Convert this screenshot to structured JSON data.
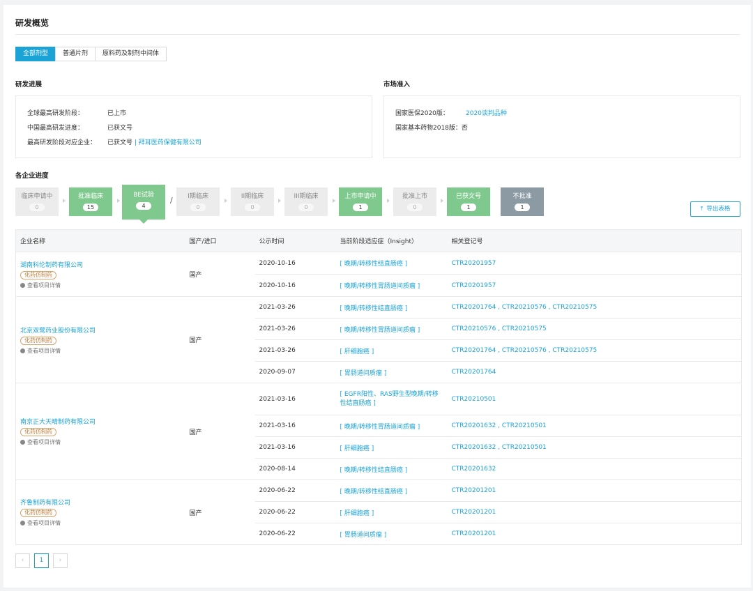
{
  "page_title": "研发概览",
  "tabs": [
    "全部剂型",
    "普通片剂",
    "原料药及制剂中间体"
  ],
  "research_progress": {
    "title": "研发进展",
    "rows": [
      {
        "label": "全球最高研发阶段：",
        "value": "已上市"
      },
      {
        "label": "中国最高研发进度：",
        "value": "已获文号"
      },
      {
        "label": "最高研发阶段对应企业：",
        "value": "已获文号",
        "sep": " | ",
        "link": "拜耳医药保健有限公司"
      }
    ]
  },
  "market_access": {
    "title": "市场准入",
    "rows": [
      {
        "label": "国家医保2020版：",
        "value": "2020谈判品种"
      },
      {
        "label": "国家基本药物2018版：",
        "value": "否"
      }
    ]
  },
  "enterprise_progress": {
    "title": "各企业进度",
    "stages": [
      {
        "label": "临床申请中",
        "count": "0"
      },
      {
        "label": "批准临床",
        "count": "15"
      },
      {
        "label": "BE试验",
        "count": "4"
      },
      {
        "label": "I期临床",
        "count": "0"
      },
      {
        "label": "II期临床",
        "count": "0"
      },
      {
        "label": "III期临床",
        "count": "0"
      },
      {
        "label": "上市申请中",
        "count": "1"
      },
      {
        "label": "批准上市",
        "count": "0"
      },
      {
        "label": "已获文号",
        "count": "1"
      },
      {
        "label": "不批准",
        "count": "1"
      }
    ],
    "slash": "/",
    "export_label": "导出表格"
  },
  "table": {
    "headers": [
      "企业名称",
      "国产/进口",
      "公示时间",
      "当前阶段适应症（Insight）",
      "相关登记号"
    ],
    "tag": "化药仿制药",
    "view_label": "查看项目详情",
    "companies": [
      {
        "name": "湖南科伦制药有限公司",
        "origin": "国产",
        "rows": [
          {
            "date": "2020-10-16",
            "indication": "[ 晚期/转移性结直肠癌 ]",
            "reg": "CTR20201957"
          },
          {
            "date": "2020-10-16",
            "indication": "[ 晚期/转移性胃肠道间质瘤 ]",
            "reg": "CTR20201957"
          }
        ]
      },
      {
        "name": "北京双鹭药业股份有限公司",
        "origin": "国产",
        "rows": [
          {
            "date": "2021-03-26",
            "indication": "[ 晚期/转移性结直肠癌 ]",
            "reg": "CTR20201764 , CTR20210576 , CTR20210575"
          },
          {
            "date": "2021-03-26",
            "indication": "[ 晚期/转移性胃肠道间质瘤 ]",
            "reg": "CTR20210576 , CTR20210575"
          },
          {
            "date": "2021-03-26",
            "indication": "[ 肝细胞癌 ]",
            "reg": "CTR20201764 , CTR20210576 , CTR20210575"
          },
          {
            "date": "2020-09-07",
            "indication": "[ 胃肠道间质瘤 ]",
            "reg": "CTR20201764"
          }
        ]
      },
      {
        "name": "南京正大天晴制药有限公司",
        "origin": "国产",
        "rows": [
          {
            "date": "2021-03-16",
            "indication": "[ EGFR阳性、RAS野生型晚期/转移性结直肠癌 ]",
            "reg": "CTR20210501"
          },
          {
            "date": "2021-03-16",
            "indication": "[ 晚期/转移性胃肠道间质瘤 ]",
            "reg": "CTR20201632 , CTR20210501"
          },
          {
            "date": "2021-03-16",
            "indication": "[ 肝细胞癌 ]",
            "reg": "CTR20201632 , CTR20210501"
          },
          {
            "date": "2020-08-14",
            "indication": "[ 晚期/转移性结直肠癌 ]",
            "reg": "CTR20201632"
          }
        ]
      },
      {
        "name": "齐鲁制药有限公司",
        "origin": "国产",
        "rows": [
          {
            "date": "2020-06-22",
            "indication": "[ 晚期/转移性结直肠癌 ]",
            "reg": "CTR20201201"
          },
          {
            "date": "2020-06-22",
            "indication": "[ 肝细胞癌 ]",
            "reg": "CTR20201201"
          },
          {
            "date": "2020-06-22",
            "indication": "[ 胃肠道间质瘤 ]",
            "reg": "CTR20201201"
          }
        ]
      }
    ]
  },
  "pagination": {
    "prev": "‹",
    "current": "1",
    "next": "›"
  },
  "colors": {
    "accent": "#1ba3d6",
    "stage_green": "#7fc98e",
    "stage_gray": "#8b9aa3",
    "tag_orange": "#c27a35"
  }
}
